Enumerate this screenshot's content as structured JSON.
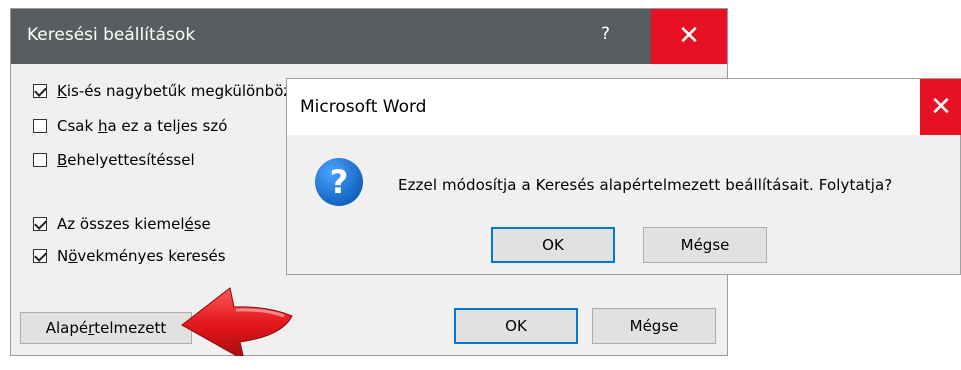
{
  "search_dialog": {
    "title": "Keresési beállítások",
    "help": "?",
    "close": "✕",
    "options": [
      {
        "pre": "",
        "u": "K",
        "post": "is-és nagybetűk megkülönböztetése",
        "checked": true
      },
      {
        "pre": "Csak ",
        "u": "h",
        "post": "a ez a teljes szó",
        "checked": false
      },
      {
        "pre": "",
        "u": "B",
        "post": "ehelyettesítéssel",
        "checked": false
      },
      {
        "pre": "Az összes kiemel",
        "u": "é",
        "post": "se",
        "checked": true
      },
      {
        "pre": "N",
        "u": "ö",
        "post": "vekményes keresés",
        "checked": true
      }
    ],
    "default_button": {
      "pre": "Alapé",
      "u": "r",
      "post": "telmezett"
    },
    "ok_label": "OK",
    "cancel_label": "Mégse"
  },
  "message_dialog": {
    "title": "Microsoft Word",
    "close": "✕",
    "icon": "question-icon",
    "icon_glyph": "?",
    "message": "Ezzel módosítja a Keresés alapértelmezett beállításait. Folytatja?",
    "ok_label": "OK",
    "cancel_label": "Mégse"
  },
  "colors": {
    "titlebar_dark": "#585e5f",
    "close_red": "#e81123",
    "focus_blue": "#0078d7",
    "arrow_red": "#e3161b"
  }
}
